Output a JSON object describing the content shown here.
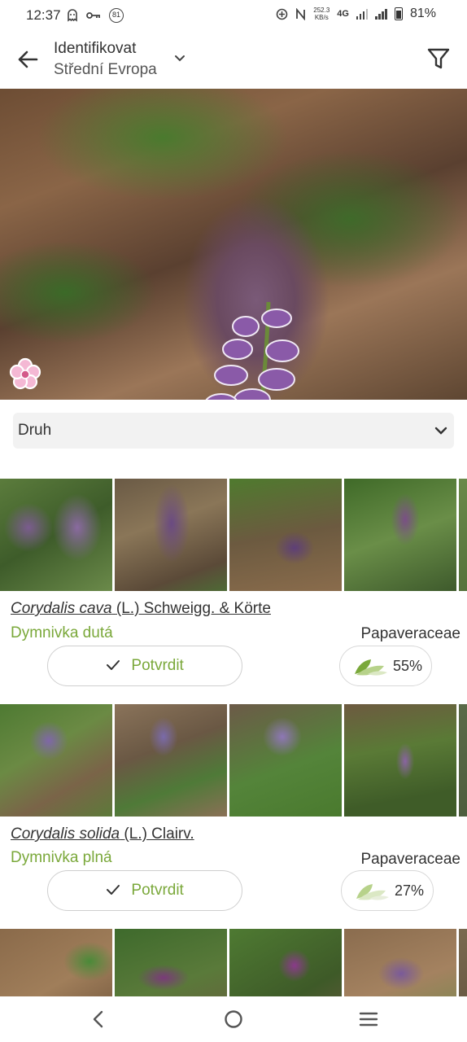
{
  "status_bar": {
    "time": "12:37",
    "notification_badge": "81",
    "net_speed_value": "252.3",
    "net_speed_unit": "KB/s",
    "network_type": "4G",
    "battery": "81%"
  },
  "header": {
    "title": "Identifikovat",
    "subtitle": "Střední Evropa",
    "icons": [
      "back-arrow-icon",
      "chevron-down-icon",
      "filter-icon"
    ]
  },
  "rank_select": {
    "selected": "Druh"
  },
  "results": [
    {
      "genus_species": "Corydalis cava",
      "author": "(L.) Schweigg. & Körte",
      "common_name": "Dymnivka dutá",
      "family": "Papaveraceae",
      "confirm_label": "Potvrdit",
      "score": "55%"
    },
    {
      "genus_species": "Corydalis solida",
      "author": "(L.) Clairv.",
      "common_name": "Dymnivka plná",
      "family": "Papaveraceae",
      "confirm_label": "Potvrdit",
      "score": "27%"
    }
  ],
  "colors": {
    "accent_green": "#7aa83a",
    "select_bg": "#f2f2f2"
  }
}
